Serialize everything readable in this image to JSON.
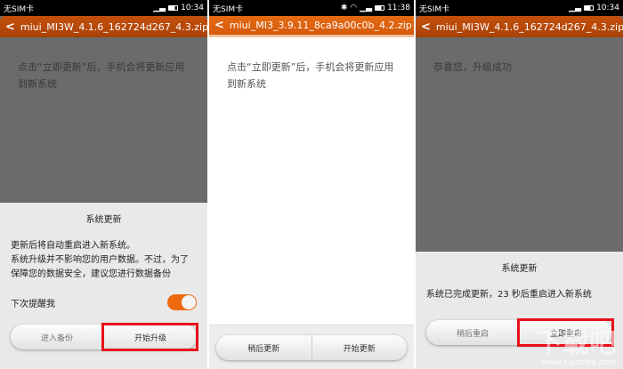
{
  "screens": [
    {
      "status": {
        "carrier": "无SIM卡",
        "time": "10:34"
      },
      "header": {
        "title": "miui_MI3W_4.1.6_162724d267_4.3.zip"
      },
      "content": "点击“立即更新”后，手机会将更新应用到新系统",
      "dialog": {
        "title": "系统更新",
        "lines": [
          "更新后将自动重启进入新系统。",
          "系统升级并不影响您的用户数据。不过，为了保障您的数据安全，建议您进行数据备份"
        ],
        "toggle_label": "下次提醒我",
        "toggle_on": true,
        "buttons": [
          "进入备份",
          "开始升级"
        ]
      }
    },
    {
      "status": {
        "carrier": "无SIM卡",
        "time": "11:38"
      },
      "header": {
        "title": "miui_MI3_3.9.11_8ca9a00c0b_4.2.zip"
      },
      "content": "点击“立即更新”后，手机会将更新应用到新系统",
      "buttons": [
        "稍后更新",
        "开始更新"
      ]
    },
    {
      "status": {
        "carrier": "无SIM卡",
        "time": "10:34"
      },
      "header": {
        "title": "miui_MI3W_4.1.6_162724d267_4.3.zip"
      },
      "content": "恭喜您，升级成功",
      "dialog": {
        "title": "系统更新",
        "text": "系统已完成更新，23 秒后重启进入新系统",
        "buttons": [
          "稍后重启",
          "立即重启"
        ]
      }
    }
  ],
  "watermark": {
    "logo": "下载吧",
    "url": "www.xiazaiba.com"
  },
  "colors": {
    "accent": "#e46a14",
    "highlight": "#e8101c"
  }
}
